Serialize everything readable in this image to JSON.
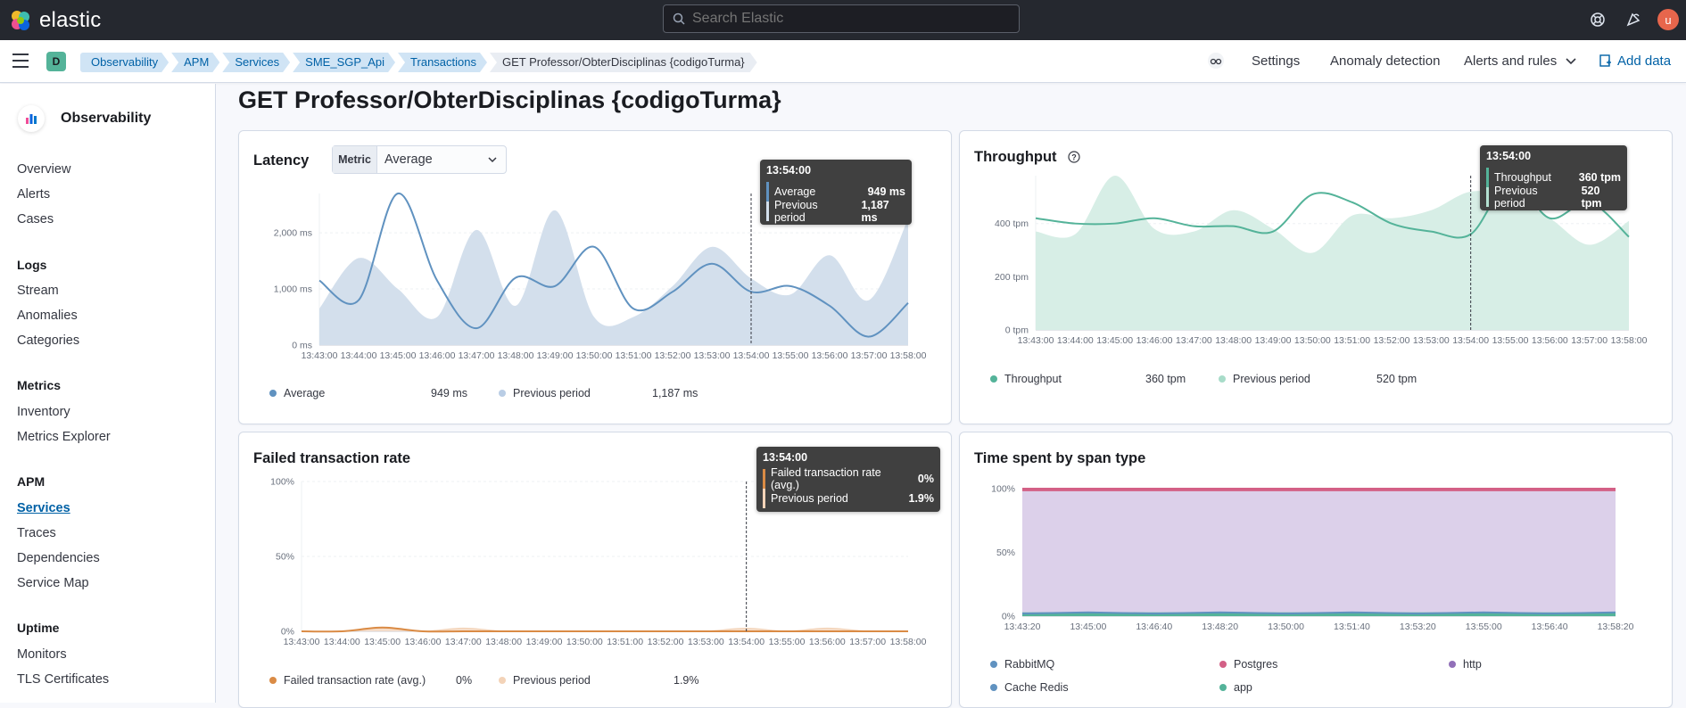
{
  "header": {
    "brand": "elastic",
    "search_placeholder": "Search Elastic",
    "user_initial": "u"
  },
  "subheader": {
    "space_initial": "D",
    "breadcrumbs": [
      "Observability",
      "APM",
      "Services",
      "SME_SGP_Api",
      "Transactions",
      "GET Professor/ObterDisciplinas {codigoTurma}"
    ],
    "settings": "Settings",
    "anomaly": "Anomaly detection",
    "alerts": "Alerts and rules",
    "add_data": "Add data"
  },
  "sidebar": {
    "title": "Observability",
    "top_items": [
      "Overview",
      "Alerts",
      "Cases"
    ],
    "groups": [
      {
        "label": "Logs",
        "items": [
          "Stream",
          "Anomalies",
          "Categories"
        ]
      },
      {
        "label": "Metrics",
        "items": [
          "Inventory",
          "Metrics Explorer"
        ]
      },
      {
        "label": "APM",
        "items": [
          "Services",
          "Traces",
          "Dependencies",
          "Service Map"
        ]
      },
      {
        "label": "Uptime",
        "items": [
          "Monitors",
          "TLS Certificates"
        ]
      }
    ],
    "active": "Services"
  },
  "page": {
    "title": "GET Professor/ObterDisciplinas {codigoTurma}"
  },
  "latency": {
    "title": "Latency",
    "metric_label": "Metric",
    "metric_value": "Average",
    "tooltip": {
      "time": "13:54:00",
      "rows": [
        {
          "label": "Average",
          "value": "949 ms"
        },
        {
          "label": "Previous period",
          "value": "1,187 ms"
        }
      ]
    },
    "legend": [
      {
        "label": "Average",
        "value": "949 ms"
      },
      {
        "label": "Previous period",
        "value": "1,187 ms"
      }
    ]
  },
  "throughput": {
    "title": "Throughput",
    "tooltip": {
      "time": "13:54:00",
      "rows": [
        {
          "label": "Throughput",
          "value": "360 tpm"
        },
        {
          "label": "Previous period",
          "value": "520 tpm"
        }
      ]
    },
    "legend": [
      {
        "label": "Throughput",
        "value": "360 tpm"
      },
      {
        "label": "Previous period",
        "value": "520 tpm"
      }
    ]
  },
  "failed": {
    "title": "Failed transaction rate",
    "tooltip": {
      "time": "13:54:00",
      "rows": [
        {
          "label": "Failed transaction rate (avg.)",
          "value": "0%"
        },
        {
          "label": "Previous period",
          "value": "1.9%"
        }
      ]
    },
    "legend": [
      {
        "label": "Failed transaction rate (avg.)",
        "value": "0%"
      },
      {
        "label": "Previous period",
        "value": "1.9%"
      }
    ]
  },
  "spans": {
    "title": "Time spent by span type",
    "legend": [
      "RabbitMQ",
      "Postgres",
      "http",
      "Cache Redis",
      "app"
    ]
  },
  "colors": {
    "latency": "#6092c0",
    "latency_prev": "#d3dfec",
    "throughput": "#54b399",
    "throughput_prev": "#d7eee6",
    "failed": "#da8b45",
    "failed_prev": "#f3d3b8",
    "span_rabbit": "#6092c0",
    "span_postgres": "#d36086",
    "span_http": "#9170b8",
    "span_redis": "#6092c0",
    "span_app": "#54b399"
  },
  "chart_data": [
    {
      "type": "line",
      "title": "Latency",
      "x": [
        "13:43:00",
        "13:44:00",
        "13:45:00",
        "13:46:00",
        "13:47:00",
        "13:48:00",
        "13:49:00",
        "13:50:00",
        "13:51:00",
        "13:52:00",
        "13:53:00",
        "13:54:00",
        "13:55:00",
        "13:56:00",
        "13:57:00",
        "13:58:00"
      ],
      "y_ticks": [
        "0 ms",
        "1,000 ms",
        "2,000 ms"
      ],
      "ylim": [
        0,
        2700
      ],
      "series": [
        {
          "name": "Average",
          "values": [
            1150,
            800,
            2700,
            1150,
            300,
            1200,
            1050,
            1750,
            650,
            950,
            1450,
            950,
            1050,
            700,
            150,
            750
          ]
        },
        {
          "name": "Previous period",
          "values": [
            650,
            1550,
            1000,
            500,
            2050,
            700,
            2400,
            500,
            500,
            1050,
            1750,
            1187,
            900,
            1600,
            800,
            2250
          ]
        }
      ]
    },
    {
      "type": "line",
      "title": "Throughput",
      "x": [
        "13:43:00",
        "13:44:00",
        "13:45:00",
        "13:46:00",
        "13:47:00",
        "13:48:00",
        "13:49:00",
        "13:50:00",
        "13:51:00",
        "13:52:00",
        "13:53:00",
        "13:54:00",
        "13:55:00",
        "13:56:00",
        "13:57:00",
        "13:58:00"
      ],
      "y_ticks": [
        "0 tpm",
        "200 tpm",
        "400 tpm"
      ],
      "ylim": [
        0,
        580
      ],
      "series": [
        {
          "name": "Throughput",
          "values": [
            420,
            400,
            400,
            420,
            390,
            390,
            370,
            510,
            480,
            400,
            370,
            360,
            560,
            420,
            480,
            350
          ]
        },
        {
          "name": "Previous period",
          "values": [
            370,
            360,
            580,
            380,
            370,
            450,
            380,
            290,
            430,
            420,
            450,
            520,
            500,
            420,
            320,
            410
          ]
        }
      ]
    },
    {
      "type": "area",
      "title": "Failed transaction rate",
      "x": [
        "13:43:00",
        "13:44:00",
        "13:45:00",
        "13:46:00",
        "13:47:00",
        "13:48:00",
        "13:49:00",
        "13:50:00",
        "13:51:00",
        "13:52:00",
        "13:53:00",
        "13:54:00",
        "13:55:00",
        "13:56:00",
        "13:57:00",
        "13:58:00"
      ],
      "y_ticks": [
        "0%",
        "50%",
        "100%"
      ],
      "ylim": [
        0,
        100
      ],
      "series": [
        {
          "name": "Failed transaction rate (avg.)",
          "values": [
            0,
            0,
            2.5,
            0,
            0,
            0,
            0,
            0,
            0,
            0,
            0,
            0,
            0,
            0,
            0,
            0
          ]
        },
        {
          "name": "Previous period",
          "values": [
            0,
            0,
            2,
            0,
            2,
            0,
            0,
            0,
            0,
            0,
            0,
            1.9,
            0,
            2,
            0,
            0
          ]
        }
      ]
    },
    {
      "type": "area",
      "title": "Time spent by span type",
      "x": [
        "13:43:20",
        "13:45:00",
        "13:46:40",
        "13:48:20",
        "13:50:00",
        "13:51:40",
        "13:53:20",
        "13:55:00",
        "13:56:40",
        "13:58:20"
      ],
      "y_ticks": [
        "0%",
        "50%",
        "100%"
      ],
      "ylim": [
        0,
        100
      ],
      "series": [
        {
          "name": "app",
          "values": [
            3,
            3,
            3,
            3,
            3,
            3,
            3,
            3,
            3,
            3
          ]
        },
        {
          "name": "http",
          "values": [
            95,
            95,
            95,
            95,
            95,
            95,
            95,
            95,
            95,
            95
          ]
        },
        {
          "name": "Postgres",
          "values": [
            2,
            2,
            2,
            2,
            2,
            2,
            2,
            2,
            2,
            2
          ]
        }
      ]
    }
  ]
}
